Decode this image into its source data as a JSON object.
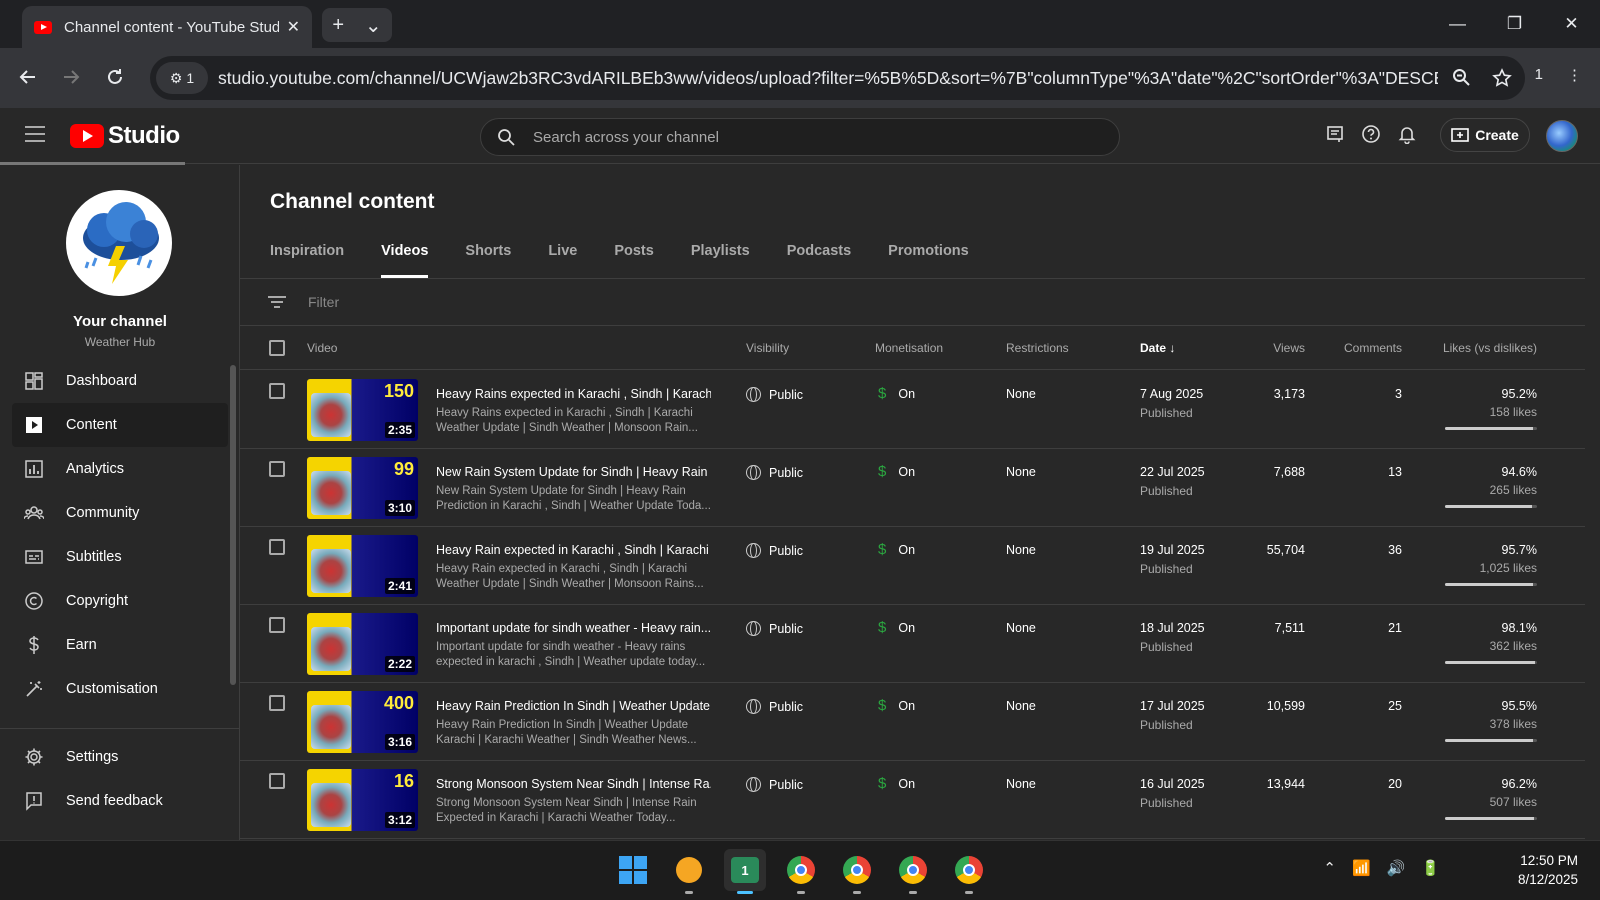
{
  "browser": {
    "tab_title": "Channel content - YouTube Studio",
    "tab_close": "✕",
    "new_tab": "+",
    "tab_menu": "⌄",
    "site_info_count": "1",
    "url": "studio.youtube.com/channel/UCWjaw2b3RC3vdARILBEb3ww/videos/upload?filter=%5B%5D&sort=%7B\"columnType\"%3A\"date\"%2C\"sortOrder\"%3A\"DESCE...",
    "profile_count": "1",
    "win_min": "—",
    "win_restore": "❐",
    "win_close": "✕"
  },
  "studio": {
    "logo_text": "Studio",
    "search_placeholder": "Search across your channel",
    "create_label": "Create"
  },
  "sidebar": {
    "channel_label": "Your channel",
    "channel_name": "Weather Hub",
    "items": [
      {
        "label": "Dashboard",
        "icon": "dashboard-icon"
      },
      {
        "label": "Content",
        "icon": "content-icon"
      },
      {
        "label": "Analytics",
        "icon": "analytics-icon"
      },
      {
        "label": "Community",
        "icon": "community-icon"
      },
      {
        "label": "Subtitles",
        "icon": "subtitles-icon"
      },
      {
        "label": "Copyright",
        "icon": "copyright-icon"
      },
      {
        "label": "Earn",
        "icon": "earn-icon"
      },
      {
        "label": "Customisation",
        "icon": "customisation-icon"
      }
    ],
    "bottom_items": [
      {
        "label": "Settings",
        "icon": "settings-icon"
      },
      {
        "label": "Send feedback",
        "icon": "feedback-icon"
      }
    ]
  },
  "main": {
    "title": "Channel content",
    "tabs": [
      "Inspiration",
      "Videos",
      "Shorts",
      "Live",
      "Posts",
      "Playlists",
      "Podcasts",
      "Promotions"
    ],
    "active_tab": "Videos",
    "filter_placeholder": "Filter",
    "columns": {
      "video": "Video",
      "visibility": "Visibility",
      "monetisation": "Monetisation",
      "restrictions": "Restrictions",
      "date": "Date",
      "views": "Views",
      "comments": "Comments",
      "likes": "Likes (vs dislikes)"
    },
    "rows": [
      {
        "thumb_num": "150",
        "duration": "2:35",
        "title": "Heavy Rains expected in Karachi , Sindh | Karach...",
        "desc": "Heavy Rains expected in Karachi , Sindh | Karachi Weather Update | Sindh Weather | Monsoon Rain...",
        "visibility": "Public",
        "monetisation": "On",
        "restrictions": "None",
        "date": "7 Aug 2025",
        "status": "Published",
        "views": "3,173",
        "comments": "3",
        "likes_pct": "95.2%",
        "likes_count": "158 likes",
        "likes_ratio": 0.952
      },
      {
        "thumb_num": "99",
        "duration": "3:10",
        "title": "New Rain System Update for Sindh | Heavy Rain ...",
        "desc": "New Rain System Update for Sindh | Heavy Rain Prediction in Karachi , Sindh | Weather Update Toda...",
        "visibility": "Public",
        "monetisation": "On",
        "restrictions": "None",
        "date": "22 Jul 2025",
        "status": "Published",
        "views": "7,688",
        "comments": "13",
        "likes_pct": "94.6%",
        "likes_count": "265 likes",
        "likes_ratio": 0.946
      },
      {
        "thumb_num": "",
        "duration": "2:41",
        "title": "Heavy Rain expected in Karachi , Sindh | Karachi ...",
        "desc": "Heavy Rain expected in Karachi , Sindh | Karachi Weather Update | Sindh Weather | Monsoon Rains...",
        "visibility": "Public",
        "monetisation": "On",
        "restrictions": "None",
        "date": "19 Jul 2025",
        "status": "Published",
        "views": "55,704",
        "comments": "36",
        "likes_pct": "95.7%",
        "likes_count": "1,025 likes",
        "likes_ratio": 0.957
      },
      {
        "thumb_num": "",
        "duration": "2:22",
        "title": "Important update for sindh weather - Heavy rain...",
        "desc": "Important update for sindh weather - Heavy rains expected in karachi , Sindh | Weather update today...",
        "visibility": "Public",
        "monetisation": "On",
        "restrictions": "None",
        "date": "18 Jul 2025",
        "status": "Published",
        "views": "7,511",
        "comments": "21",
        "likes_pct": "98.1%",
        "likes_count": "362 likes",
        "likes_ratio": 0.981
      },
      {
        "thumb_num": "400",
        "duration": "3:16",
        "title": "Heavy Rain Prediction In Sindh | Weather Update ...",
        "desc": "Heavy Rain Prediction In Sindh | Weather Update Karachi | Karachi Weather | Sindh Weather News...",
        "visibility": "Public",
        "monetisation": "On",
        "restrictions": "None",
        "date": "17 Jul 2025",
        "status": "Published",
        "views": "10,599",
        "comments": "25",
        "likes_pct": "95.5%",
        "likes_count": "378 likes",
        "likes_ratio": 0.955
      },
      {
        "thumb_num": "16",
        "duration": "3:12",
        "title": "Strong Monsoon System Near Sindh | Intense Ra...",
        "desc": "Strong Monsoon System Near Sindh | Intense Rain Expected in Karachi | Karachi Weather Today...",
        "visibility": "Public",
        "monetisation": "On",
        "restrictions": "None",
        "date": "16 Jul 2025",
        "status": "Published",
        "views": "13,944",
        "comments": "20",
        "likes_pct": "96.2%",
        "likes_count": "507 likes",
        "likes_ratio": 0.962
      }
    ]
  },
  "taskbar": {
    "time": "12:50 PM",
    "date": "8/12/2025",
    "badge": "1",
    "apps": [
      "start-icon",
      "app-icon",
      "store-icon",
      "chrome-icon",
      "chrome-icon",
      "chrome-icon",
      "chrome-icon"
    ]
  }
}
